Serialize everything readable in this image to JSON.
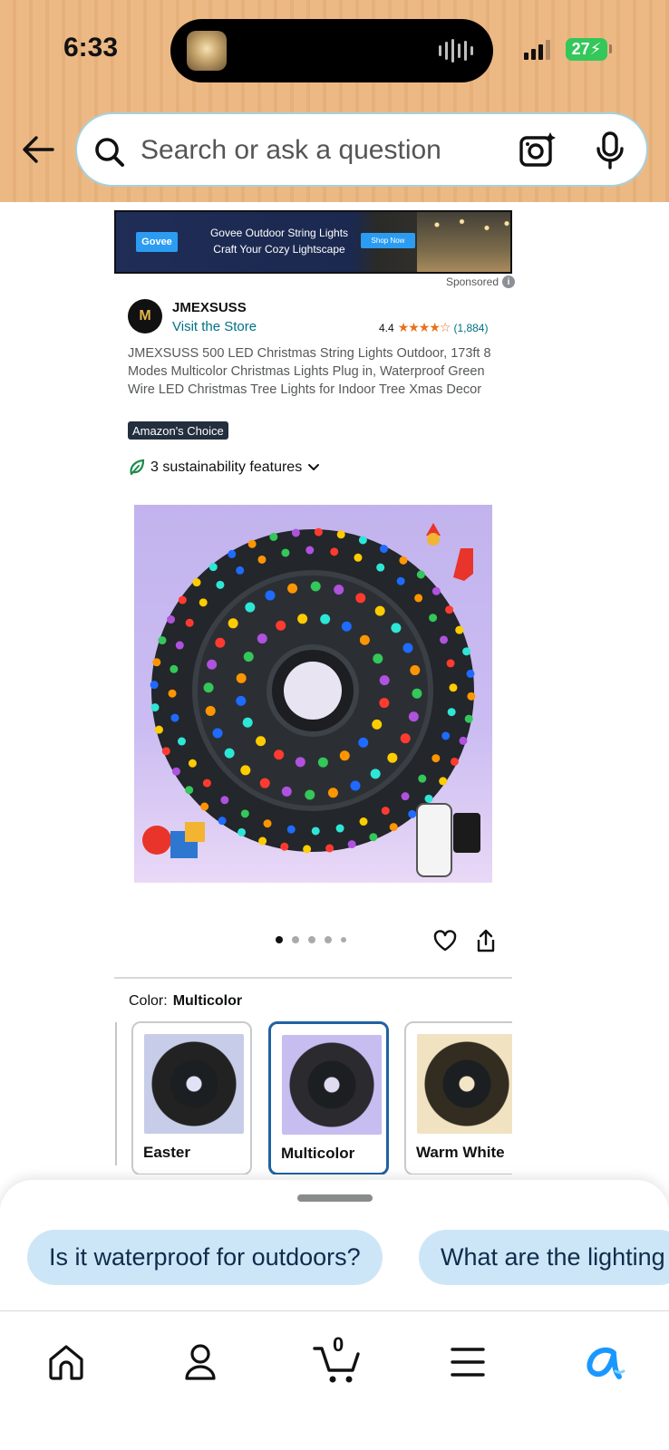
{
  "status_bar": {
    "time": "6:33",
    "battery": "27"
  },
  "header": {
    "search_placeholder": "Search or ask a question",
    "icons": [
      "back-arrow-icon",
      "search-icon",
      "camera-lens-icon",
      "microphone-icon"
    ]
  },
  "ad": {
    "logo": "Govee",
    "line1": "Govee Outdoor String Lights",
    "line2": "Craft Your Cozy Lightscape",
    "cta": "Shop Now",
    "sponsored": "Sponsored"
  },
  "product": {
    "brand": "JMEXSUSS",
    "brand_logo_text": "M",
    "visit_store": "Visit the Store",
    "rating": "4.4",
    "stars": "★★★★☆",
    "rating_count": "(1,884)",
    "title": "JMEXSUSS 500 LED Christmas String Lights Outdoor, 173ft 8 Modes Multicolor Christmas Lights Plug in, Waterproof Green Wire LED Christmas Tree Lights for Indoor Tree Xmas Decor",
    "badge": "Amazon's Choice",
    "sustainability": "3 sustainability features",
    "image_count": 5,
    "active_image": 1
  },
  "color": {
    "label": "Color:",
    "selected": "Multicolor",
    "options": [
      {
        "name": "Easter"
      },
      {
        "name": "Multicolor"
      },
      {
        "name": "Warm White"
      }
    ]
  },
  "suggestions": [
    "Is it waterproof for outdoors?",
    "What are the lighting"
  ],
  "tabbar": {
    "cart_count": "0",
    "accent": "#1a98ff"
  }
}
